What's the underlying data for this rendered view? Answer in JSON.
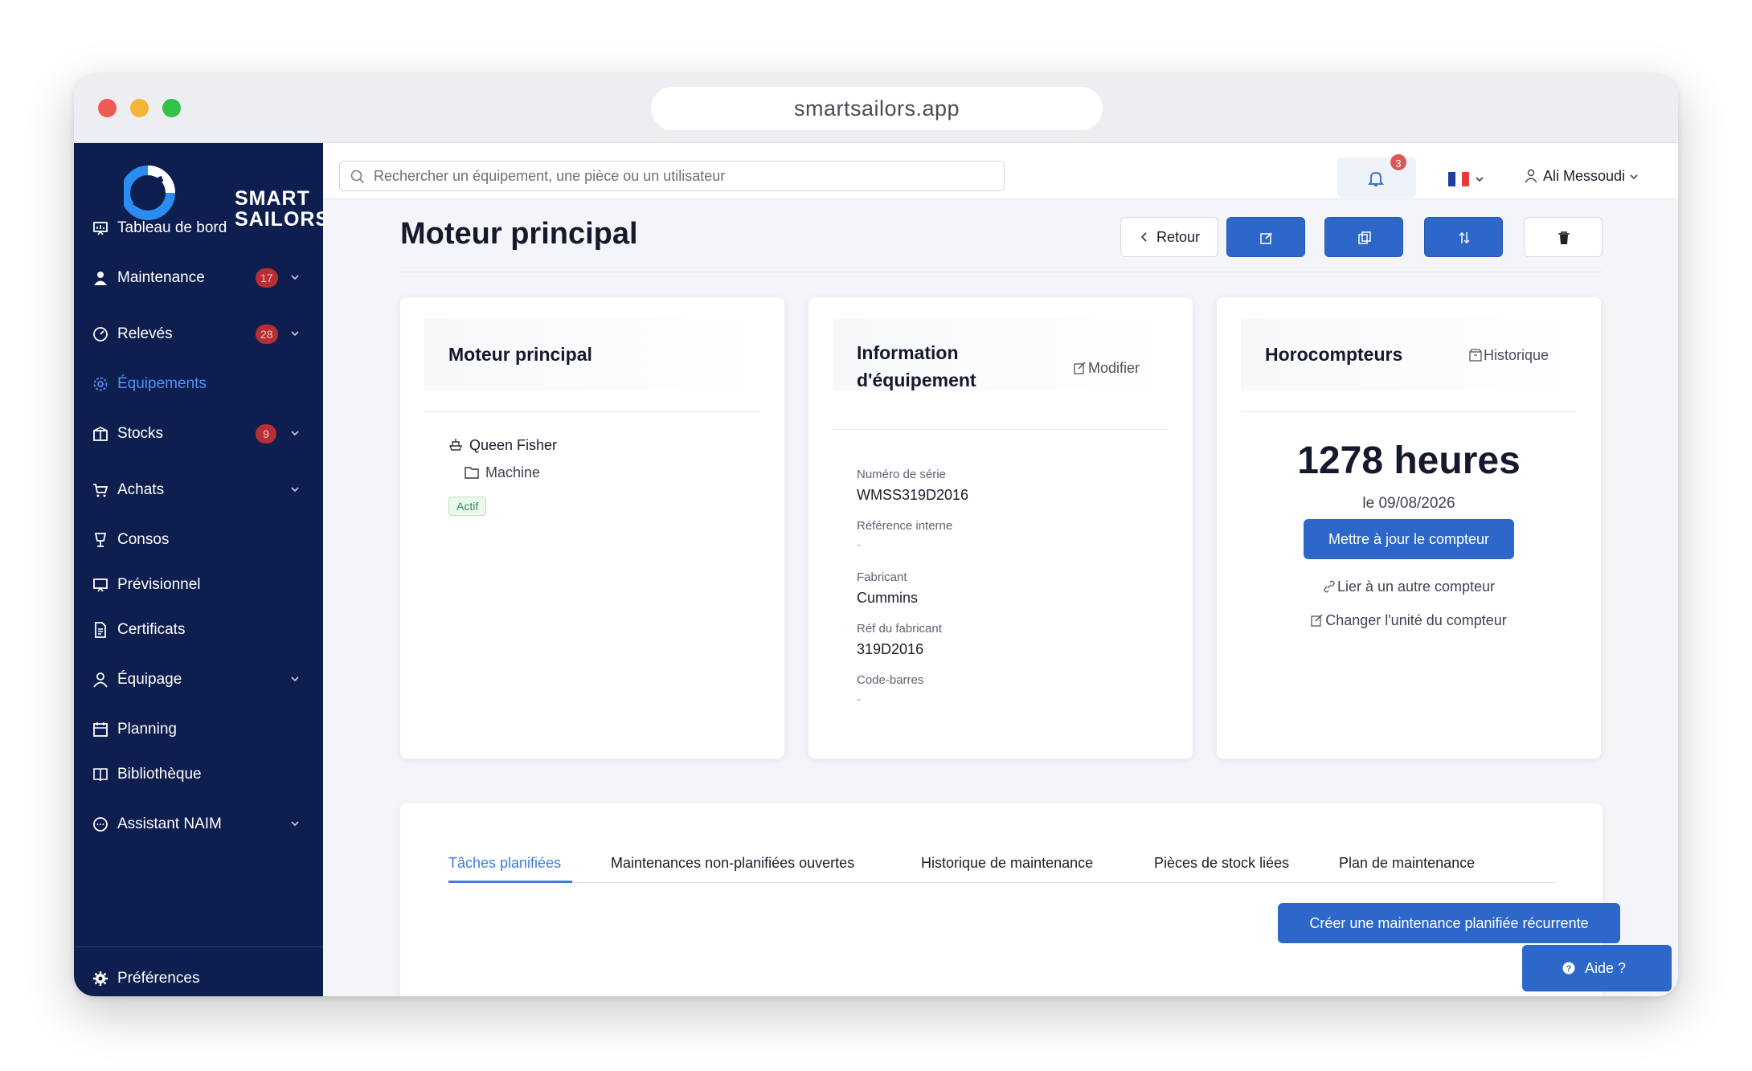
{
  "browser": {
    "url": "smartsailors.app"
  },
  "brand": {
    "line1": "SMART",
    "line2": "SAILORS"
  },
  "sidebar": {
    "items": [
      {
        "label": "Tableau de bord",
        "icon": "dashboard-icon"
      },
      {
        "label": "Maintenance",
        "badge": "17",
        "icon": "person-icon"
      },
      {
        "label": "Relevés",
        "badge": "28",
        "icon": "gauge-icon"
      },
      {
        "label": "Équipements",
        "active": true,
        "icon": "gear-icon"
      },
      {
        "label": "Stocks",
        "badge": "9",
        "icon": "box-icon"
      },
      {
        "label": "Achats",
        "icon": "cart-icon"
      },
      {
        "label": "Consos",
        "icon": "cup-icon"
      },
      {
        "label": "Prévisionnel",
        "icon": "presentation-icon"
      },
      {
        "label": "Certificats",
        "icon": "document-icon"
      },
      {
        "label": "Équipage",
        "icon": "user-icon"
      },
      {
        "label": "Planning",
        "icon": "calendar-icon"
      },
      {
        "label": "Bibliothèque",
        "icon": "book-icon"
      },
      {
        "label": "Assistant NAIM",
        "icon": "chat-icon"
      }
    ],
    "footer": {
      "label": "Préférences",
      "icon": "settings-icon"
    }
  },
  "topbar": {
    "search_placeholder": "Rechercher un équipement, une pièce ou un utilisateur",
    "notifications_count": "3",
    "language": "fr",
    "user_name": "Ali Messoudi"
  },
  "page": {
    "title": "Moteur principal",
    "back_label": "Retour"
  },
  "card_main": {
    "title": "Moteur principal",
    "vessel": "Queen Fisher",
    "category": "Machine",
    "status": "Actif"
  },
  "card_info": {
    "title_line1": "Information",
    "title_line2": "d'équipement",
    "edit_label": "Modifier",
    "fields": [
      {
        "label": "Numéro de série",
        "value": "WMSS319D2016"
      },
      {
        "label": "Référence interne",
        "value": "-"
      },
      {
        "label": "Fabricant",
        "value": "Cummins"
      },
      {
        "label": "Réf du fabricant",
        "value": "319D2016"
      },
      {
        "label": "Code-barres",
        "value": "-"
      }
    ]
  },
  "card_hours": {
    "title": "Horocompteurs",
    "history_label": "Historique",
    "value": "1278 heures",
    "date": "le 09/08/2026",
    "update_button": "Mettre à jour le compteur",
    "link_other": "Lier à un autre compteur",
    "change_unit": "Changer l'unité du compteur"
  },
  "tabs": {
    "items": [
      "Tâches planifiées",
      "Maintenances non-planifiées ouvertes",
      "Historique de maintenance",
      "Pièces de stock liées",
      "Plan de maintenance"
    ],
    "active_index": 0,
    "create_button": "Créer une maintenance planifiée récurrente"
  },
  "help_button": "Aide ?",
  "colors": {
    "sidebar_bg": "#0e1f4f",
    "primary": "#2c67c9",
    "active_nav": "#4f8ff7",
    "badge": "#b72f33"
  }
}
